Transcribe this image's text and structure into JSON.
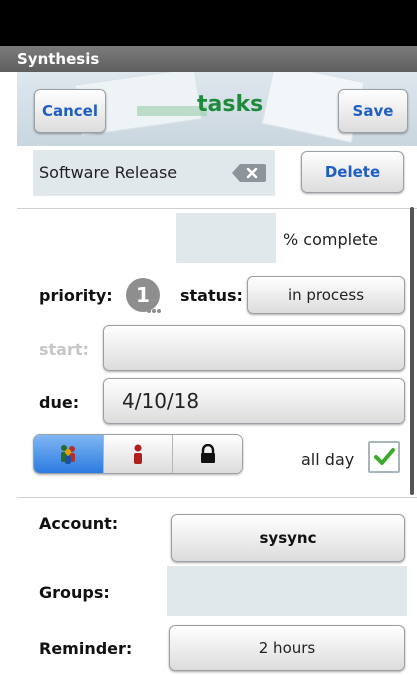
{
  "app": {
    "title": "Synthesis"
  },
  "header": {
    "cancel_label": "Cancel",
    "title": "tasks",
    "save_label": "Save"
  },
  "task": {
    "name": "Software Release",
    "delete_label": "Delete",
    "percent_complete_label": "% complete",
    "percent_complete_value": "",
    "priority_label": "priority:",
    "priority_value": "1",
    "status_label": "status:",
    "status_value": "in process",
    "start_label": "start:",
    "start_value": "",
    "due_label": "due:",
    "due_value": "4/10/18",
    "all_day_label": "all day",
    "all_day_checked": true,
    "privacy_segments": [
      {
        "icon": "group-icon",
        "active": true
      },
      {
        "icon": "person-icon",
        "active": false
      },
      {
        "icon": "lock-icon",
        "active": false
      }
    ]
  },
  "details": {
    "account_label": "Account:",
    "account_value": "sysync",
    "groups_label": "Groups:",
    "groups_value": "",
    "reminder_label": "Reminder:",
    "reminder_value": "2 hours"
  },
  "colors": {
    "accent_green": "#1e8a3b",
    "button_blue": "#1f5fc3",
    "segment_active": "#2c7be0",
    "field_bg": "#e1e8ec"
  }
}
